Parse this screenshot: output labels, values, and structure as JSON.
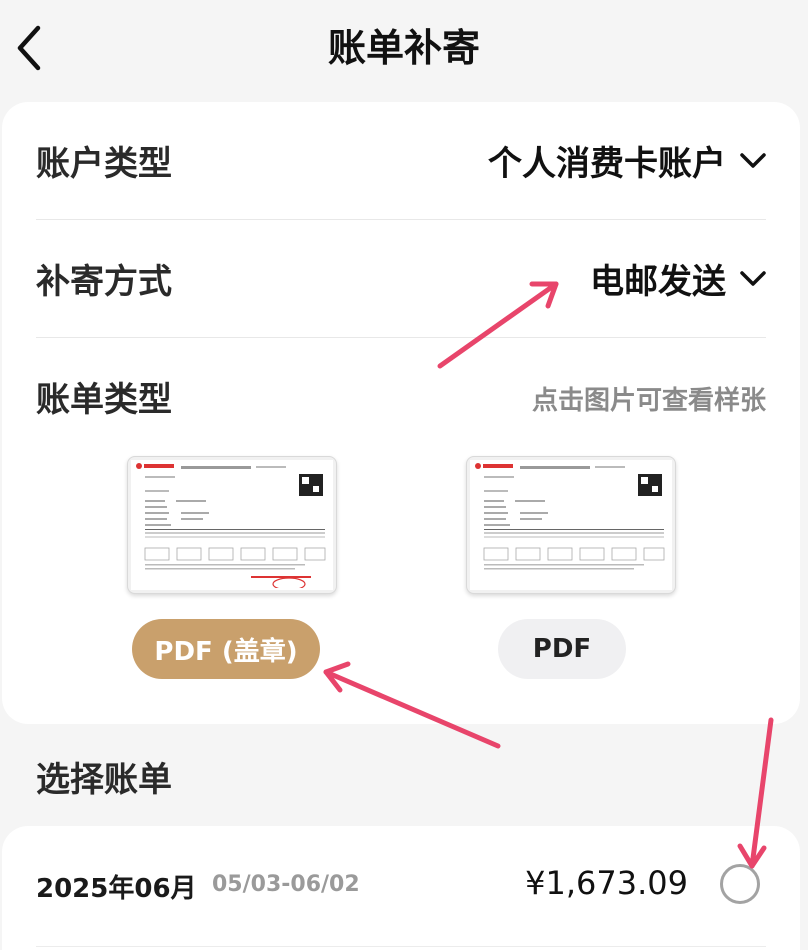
{
  "header": {
    "title": "账单补寄",
    "back_icon": "chevron-left-icon"
  },
  "form": {
    "account_type": {
      "label": "账户类型",
      "value": "个人消费卡账户"
    },
    "delivery_method": {
      "label": "补寄方式",
      "value": "电邮发送"
    },
    "bill_type": {
      "label": "账单类型",
      "hint": "点击图片可查看样张",
      "options": [
        {
          "label": "PDF (盖章)",
          "selected": true
        },
        {
          "label": "PDF",
          "selected": false
        }
      ]
    }
  },
  "bill_section": {
    "title": "选择账单",
    "items": [
      {
        "month": "2025年06月",
        "range": "05/03-06/02",
        "amount": "¥1,673.09",
        "selected": false
      }
    ]
  },
  "colors": {
    "accent": "#c9a06c",
    "annotation_arrow": "#e8456b"
  }
}
